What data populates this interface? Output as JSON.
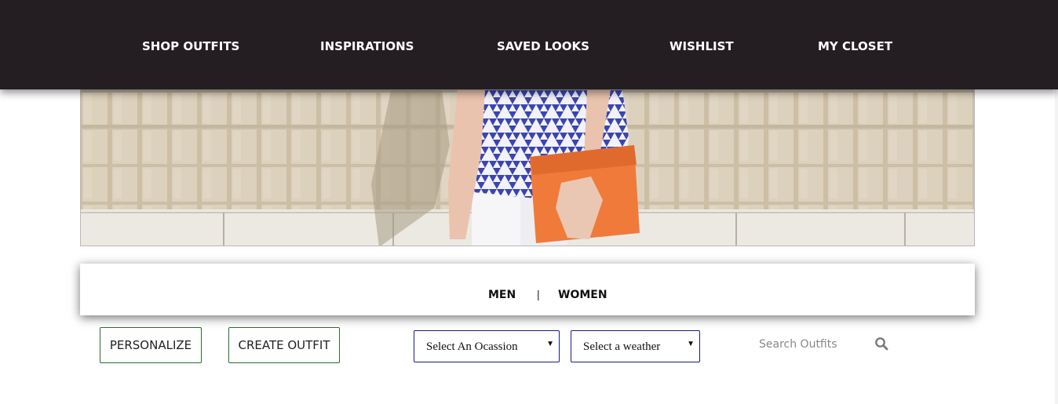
{
  "nav": {
    "items": [
      {
        "label": "SHOP OUTFITS"
      },
      {
        "label": "INSPIRATIONS"
      },
      {
        "label": "SAVED LOOKS"
      },
      {
        "label": "WISHLIST"
      },
      {
        "label": "MY CLOSET"
      }
    ],
    "background": "#241e23"
  },
  "gender": {
    "men": "MEN",
    "separator": "|",
    "women": "WOMEN"
  },
  "controls": {
    "personalize": "PERSONALIZE",
    "create_outfit": "CREATE OUTFIT",
    "occasion_select": "Select An Ocassion",
    "weather_select": "Select a weather",
    "search_placeholder": "Search Outfits",
    "search_icon": "search-icon"
  },
  "colors": {
    "button_border": "#2e6b2e",
    "select_border": "#1a1a8c",
    "clutch": "#f07a3a"
  }
}
